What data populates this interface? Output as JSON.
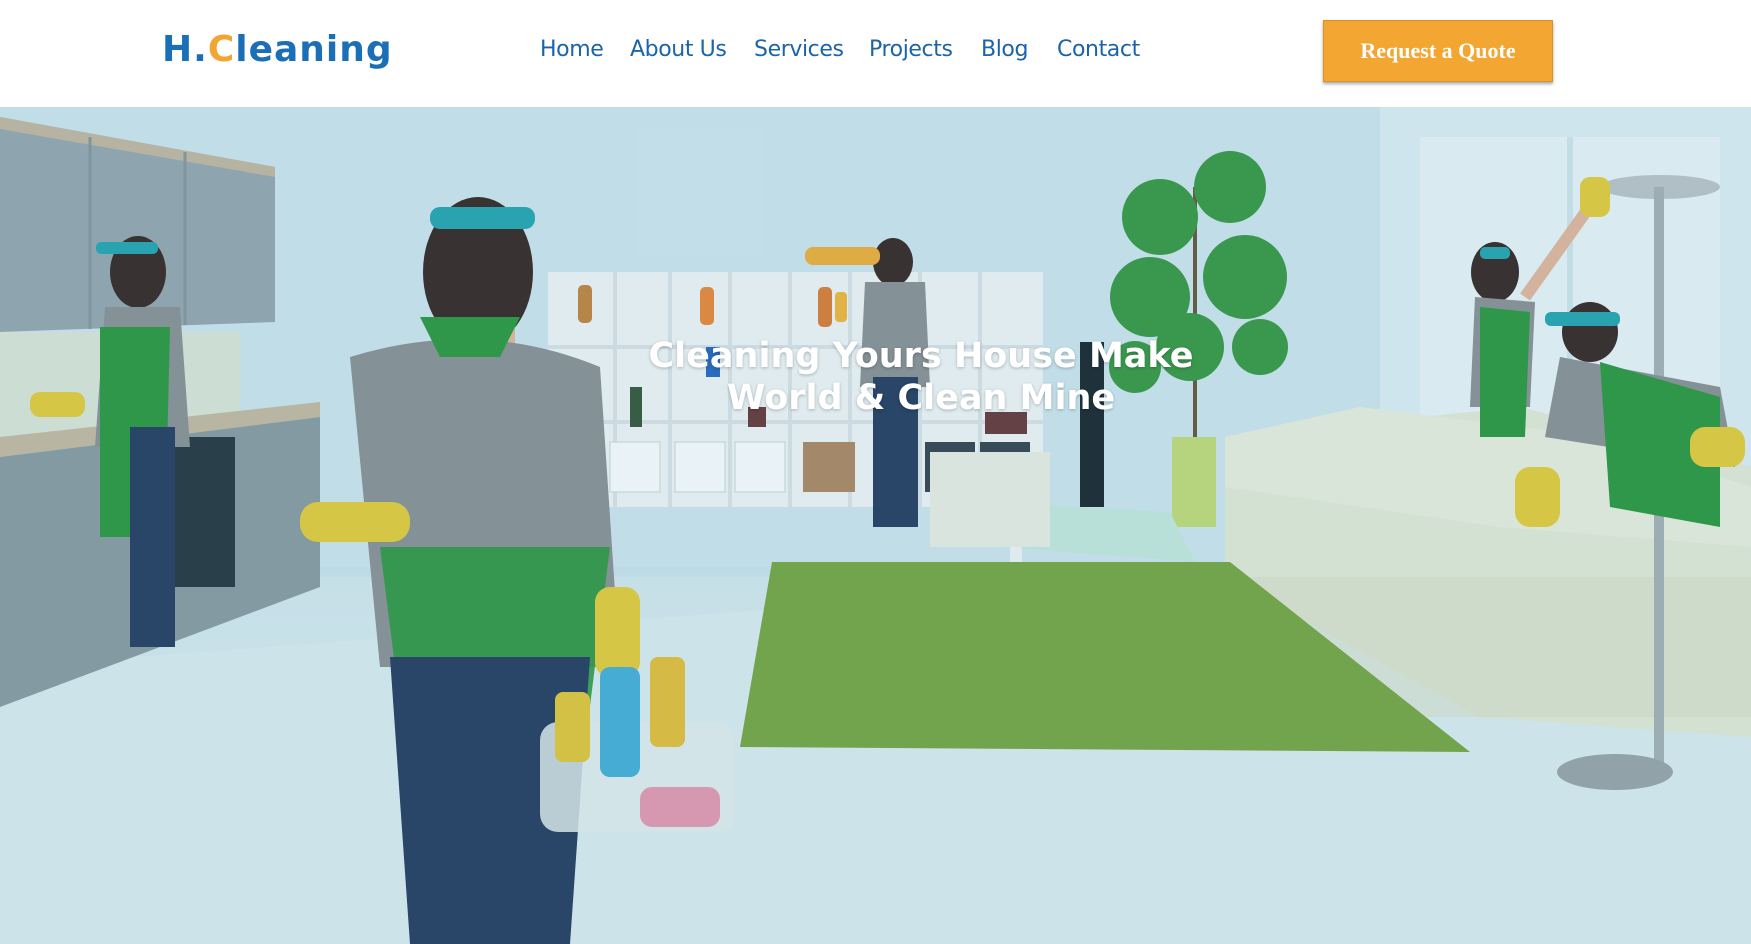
{
  "brand": {
    "logo_part1": "H.",
    "logo_part2": "C",
    "logo_part3": "leaning",
    "primary_color": "#1a6fb6",
    "accent_color": "#f2a531"
  },
  "nav": {
    "items": [
      {
        "label": "Home"
      },
      {
        "label": "About Us"
      },
      {
        "label": "Services"
      },
      {
        "label": "Projects"
      },
      {
        "label": "Blog"
      },
      {
        "label": "Contact"
      }
    ]
  },
  "header": {
    "cta_label": "Request a Quote",
    "cta_color": "#f3a732"
  },
  "hero": {
    "title_line1": "Cleaning Yours House Make",
    "title_line2": "World & Clean Mine",
    "background_image": "living-room-cleaning-photo"
  }
}
